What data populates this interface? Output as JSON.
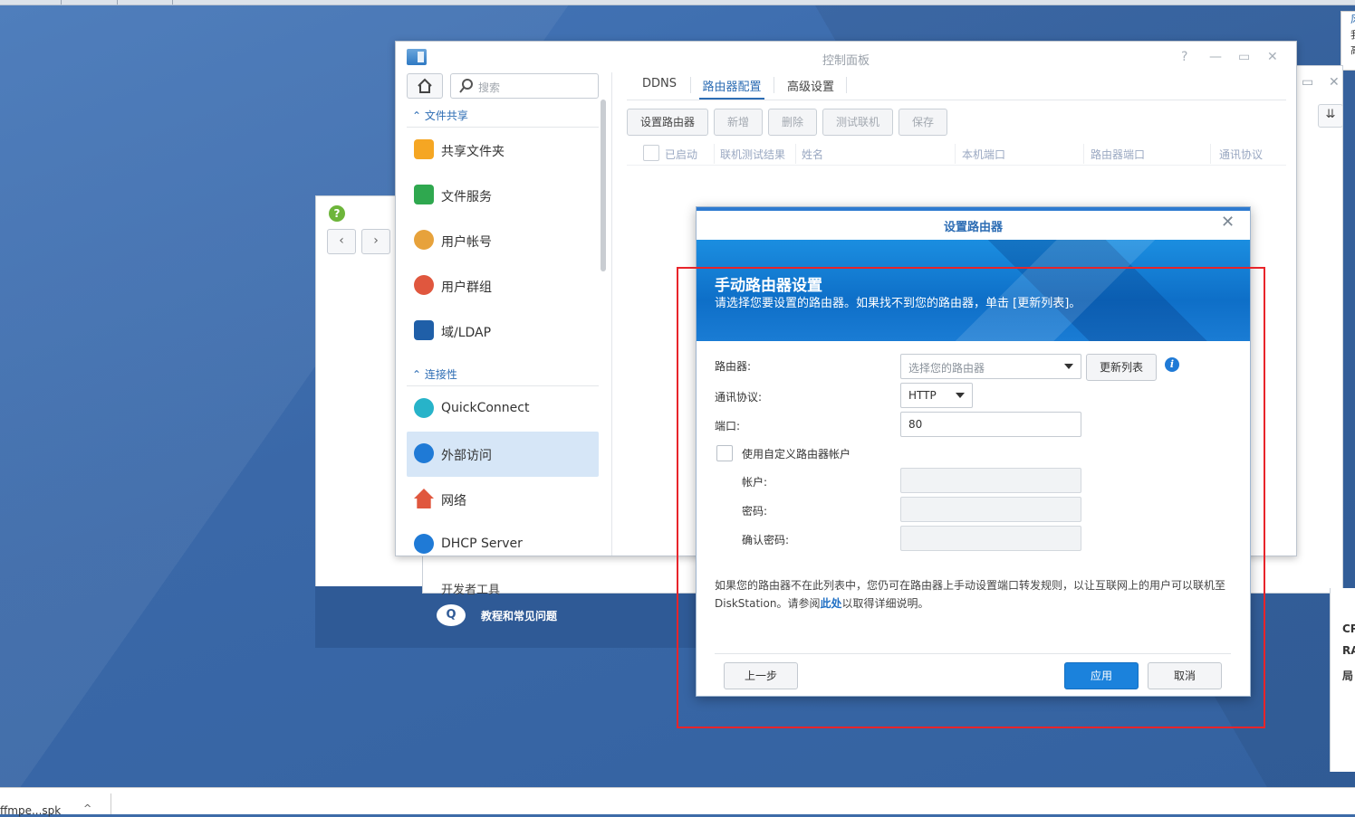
{
  "desktop": {
    "taskbar": {
      "download_name": "ffmpe...spk",
      "caret": "^"
    },
    "notification": {
      "lines": [
        "风",
        "我",
        "高"
      ]
    },
    "widget": {
      "labels": [
        "CP",
        "RA",
        "局"
      ]
    }
  },
  "help_window": {
    "footer_icon": "Q",
    "footer_text": "教程和常见问题"
  },
  "bg_window": {
    "dev_tools": "开发者工具"
  },
  "control_panel": {
    "title": "控制面板",
    "search_placeholder": "搜索",
    "sections": [
      {
        "label": "文件共享"
      },
      {
        "label": "连接性"
      }
    ],
    "items": [
      {
        "label": "共享文件夹",
        "icon": "shared-folder-icon",
        "color": "#f5a623"
      },
      {
        "label": "文件服务",
        "icon": "file-services-icon",
        "color": "#2fa84f"
      },
      {
        "label": "用户帐号",
        "icon": "user-icon",
        "color": "#e7a23b"
      },
      {
        "label": "用户群组",
        "icon": "group-icon",
        "color": "#e0573e"
      },
      {
        "label": "域/LDAP",
        "icon": "domain-ldap-icon",
        "color": "#1f5fa8"
      },
      {
        "label": "QuickConnect",
        "icon": "quickconnect-icon",
        "color": "#27b3c9"
      },
      {
        "label": "外部访问",
        "icon": "external-access-icon",
        "color": "#1f7ad6"
      },
      {
        "label": "网络",
        "icon": "network-icon",
        "color": "#e0573e"
      },
      {
        "label": "DHCP Server",
        "icon": "dhcp-server-icon",
        "color": "#1f7ad6"
      }
    ],
    "tabs": [
      "DDNS",
      "路由器配置",
      "高级设置"
    ],
    "toolbar": [
      "设置路由器",
      "新增",
      "删除",
      "测试联机",
      "保存"
    ],
    "columns": [
      "已启动",
      "联机测试结果",
      "姓名",
      "本机端口",
      "路由器端口",
      "通讯协议"
    ]
  },
  "dialog": {
    "title": "设置路由器",
    "banner_title": "手动路由器设置",
    "banner_subtitle": "请选择您要设置的路由器。如果找不到您的路由器，单击 [更新列表]。",
    "router_label": "路由器:",
    "router_placeholder": "选择您的路由器",
    "refresh_button": "更新列表",
    "protocol_label": "通讯协议:",
    "protocol_value": "HTTP",
    "port_label": "端口:",
    "port_value": "80",
    "custom_account_label": "使用自定义路由器帐户",
    "custom_account_checked": false,
    "account_label": "帐户:",
    "password_label": "密码:",
    "confirm_password_label": "确认密码:",
    "note_before": "如果您的路由器不在此列表中，您仍可在路由器上手动设置端口转发规则，以让互联网上的用户可以联机至 DiskStation。请参阅",
    "note_link": "此处",
    "note_after": "以取得详细说明。",
    "back_button": "上一步",
    "apply_button": "应用",
    "cancel_button": "取消"
  },
  "colors": {
    "accent": "#2d6db4",
    "primary_button": "#1b82dc",
    "highlight_box": "#e8242a"
  }
}
